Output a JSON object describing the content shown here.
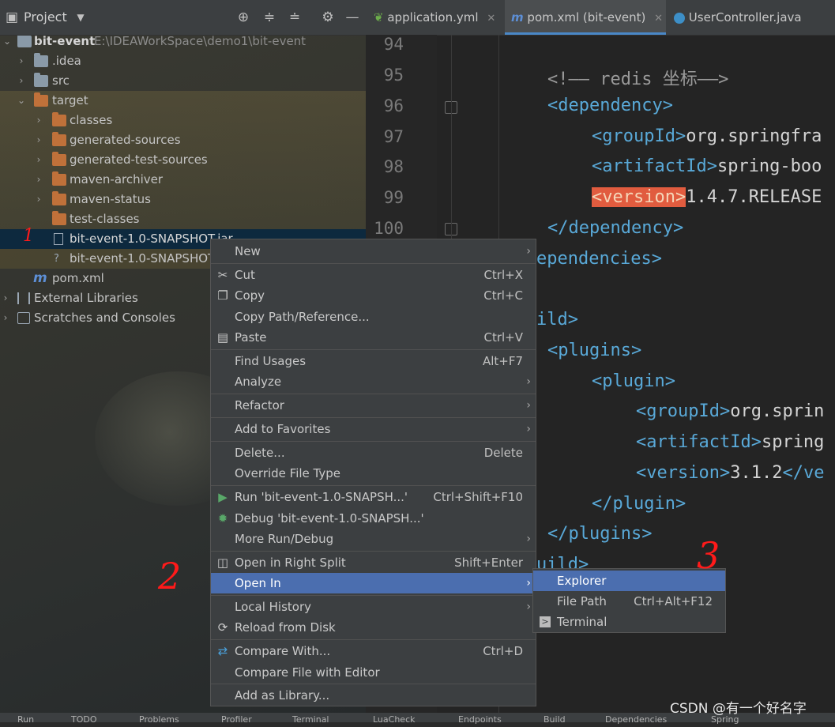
{
  "project_panel": {
    "title": "Project",
    "tree": [
      {
        "label": "bit-event",
        "path": "E:\\IDEAWorkSpace\\demo1\\bit-event"
      },
      {
        "label": ".idea"
      },
      {
        "label": "src"
      },
      {
        "label": "target"
      },
      {
        "label": "classes"
      },
      {
        "label": "generated-sources"
      },
      {
        "label": "generated-test-sources"
      },
      {
        "label": "maven-archiver"
      },
      {
        "label": "maven-status"
      },
      {
        "label": "test-classes"
      },
      {
        "label": "bit-event-1.0-SNAPSHOT.jar"
      },
      {
        "label": "bit-event-1.0-SNAPSHOT"
      },
      {
        "label": "pom.xml"
      },
      {
        "label": "External Libraries"
      },
      {
        "label": "Scratches and Consoles"
      }
    ]
  },
  "editor": {
    "tabs": [
      {
        "label": "application.yml"
      },
      {
        "label": "pom.xml (bit-event)"
      },
      {
        "label": "UserController.java"
      }
    ],
    "line_numbers": [
      "94",
      "95",
      "96",
      "97",
      "98",
      "99",
      "100"
    ],
    "code": {
      "l95_comment": "<!—— redis 坐标——>",
      "l96_open": "<dependency>",
      "l97_tag": "<groupId>",
      "l97_text": "org.springfra",
      "l98_tag": "<artifactId>",
      "l98_text": "spring-boo",
      "l99_tag": "<version>",
      "l99_text": "1.4.7.RELEASE",
      "l100_close": "</dependency>",
      "l101": "ependencies>",
      "l103": "ild>",
      "l104": "<plugins>",
      "l105": "<plugin>",
      "l106_tag": "<groupId>",
      "l106_text": "org.sprin",
      "l107_tag": "<artifactId>",
      "l107_text": "spring",
      "l108_tag": "<version>",
      "l108_text": "3.1.2",
      "l108_close": "</ve",
      "l109": "</plugin>",
      "l110": "</plugins>",
      "l111": "uild>"
    }
  },
  "context_menu": {
    "items": [
      {
        "label": "New",
        "shortcut": "",
        "submenu": true
      },
      {
        "label": "Cut",
        "shortcut": "Ctrl+X",
        "icon": "scissors-icon"
      },
      {
        "label": "Copy",
        "shortcut": "Ctrl+C",
        "icon": "copy-icon"
      },
      {
        "label": "Copy Path/Reference...",
        "shortcut": ""
      },
      {
        "label": "Paste",
        "shortcut": "Ctrl+V",
        "icon": "clipboard-icon"
      },
      {
        "label": "Find Usages",
        "shortcut": "Alt+F7"
      },
      {
        "label": "Analyze",
        "shortcut": "",
        "submenu": true
      },
      {
        "label": "Refactor",
        "shortcut": "",
        "submenu": true
      },
      {
        "label": "Add to Favorites",
        "shortcut": "",
        "submenu": true
      },
      {
        "label": "Delete...",
        "shortcut": "Delete"
      },
      {
        "label": "Override File Type",
        "shortcut": ""
      },
      {
        "label": "Run 'bit-event-1.0-SNAPSH...'",
        "shortcut": "Ctrl+Shift+F10",
        "icon": "run-icon"
      },
      {
        "label": "Debug 'bit-event-1.0-SNAPSH...'",
        "shortcut": "",
        "icon": "debug-icon"
      },
      {
        "label": "More Run/Debug",
        "shortcut": "",
        "submenu": true
      },
      {
        "label": "Open in Right Split",
        "shortcut": "Shift+Enter",
        "icon": "split-icon"
      },
      {
        "label": "Open In",
        "shortcut": "",
        "submenu": true
      },
      {
        "label": "Local History",
        "shortcut": "",
        "submenu": true
      },
      {
        "label": "Reload from Disk",
        "shortcut": "",
        "icon": "reload-icon"
      },
      {
        "label": "Compare With...",
        "shortcut": "Ctrl+D",
        "icon": "compare-icon"
      },
      {
        "label": "Compare File with Editor",
        "shortcut": ""
      },
      {
        "label": "Add as Library...",
        "shortcut": ""
      }
    ]
  },
  "submenu": {
    "items": [
      {
        "label": "Explorer",
        "shortcut": ""
      },
      {
        "label": "File Path",
        "shortcut": "Ctrl+Alt+F12"
      },
      {
        "label": "Terminal",
        "shortcut": "",
        "icon": "terminal-icon"
      }
    ]
  },
  "annotations": {
    "a1": "1",
    "a2": "2",
    "a3": "3"
  },
  "status_bar": {
    "items": [
      "Run",
      "TODO",
      "Problems",
      "Profiler",
      "Terminal",
      "LuaCheck",
      "Endpoints",
      "Build",
      "Dependencies",
      "Spring"
    ]
  },
  "watermark": "CSDN @有一个好名字"
}
